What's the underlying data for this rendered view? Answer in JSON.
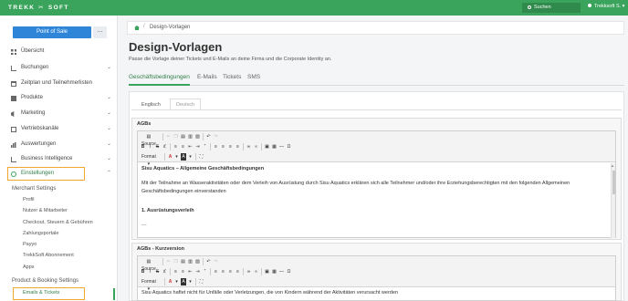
{
  "topbar": {
    "logo_left": "TREKK",
    "logo_right": "SOFT",
    "search_label": "Suchen",
    "user_label": "Trekksoft S."
  },
  "sidebar": {
    "pos_button": "Point of Sale",
    "pos_more": "...",
    "nav": [
      {
        "label": "Übersicht",
        "icon": "dashboard-icon"
      },
      {
        "label": "Buchungen",
        "icon": "cart-icon"
      },
      {
        "label": "Zeitplan und Teilnehmerlisten",
        "icon": "calendar-icon"
      },
      {
        "label": "Produkte",
        "icon": "box-icon"
      },
      {
        "label": "Marketing",
        "icon": "megaphone-icon"
      },
      {
        "label": "Vertriebskanäle",
        "icon": "sitemap-icon"
      },
      {
        "label": "Auswertungen",
        "icon": "bar-chart-icon"
      },
      {
        "label": "Business Intelligence",
        "icon": "line-chart-icon"
      },
      {
        "label": "Einstellungen",
        "icon": "gear-icon"
      }
    ],
    "merchant_heading": "Merchant Settings",
    "merchant_items": [
      "Profil",
      "Nutzer & Mitarbeiter",
      "Checkout, Steuern & Gebühren",
      "Zahlungsportale",
      "Payyo",
      "TrekkSoft Abonnement",
      "Apps"
    ],
    "product_heading": "Product & Booking Settings",
    "product_items": [
      "Emails & Tickets"
    ]
  },
  "main": {
    "breadcrumb": "Design-Vorlagen",
    "title": "Design-Vorlagen",
    "subtitle": "Passe die Vorlage deiner Tickets und E-Mails an deine Firma und die Corporate Identity an.",
    "tabs": [
      "Geschäftsbedingungen",
      "E-Mails",
      "Tickets",
      "SMS"
    ],
    "lang_tabs": [
      "Englisch",
      "Deutsch"
    ],
    "toolbar": {
      "source": "Source",
      "bold": "B",
      "italic": "I",
      "strike": "S",
      "format": "Format",
      "text_color": "A"
    },
    "panels": [
      {
        "label": "AGBs",
        "paragraphs": [
          "Sisu Aquatics – Allgemeine Geschäftsbedingungen",
          "Mit der Teilnahme an Wasseraktivitäten oder dem Verleih von Ausrüstung durch Sisu Aquatics erklären sich alle Teilnehmer und/oder ihre Erziehungsberechtigten mit den folgenden Allgemeinen Geschäftsbedingungen einverstanden",
          "1. Ausrüstungsverleih"
        ]
      },
      {
        "label": "AGBs - Kurzversion",
        "paragraphs": [
          "Sisu Aquatics haftet nicht für Unfälle oder Verletzungen, die von Kindern während der Aktivitäten verursacht werden"
        ]
      }
    ]
  }
}
